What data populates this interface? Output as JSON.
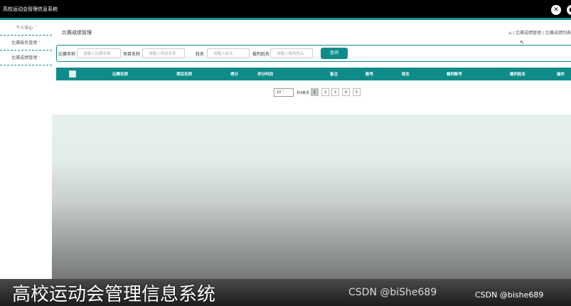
{
  "header": {
    "app_title": "高校运动会管理信息系统",
    "fullscreen_icon": "close-icon",
    "user_icon": "user-icon"
  },
  "sidebar": {
    "items": [
      {
        "label": "个人中心"
      },
      {
        "label": "比赛报名管理"
      },
      {
        "label": "比赛成绩管理"
      }
    ]
  },
  "main": {
    "page_title": "比赛成绩管理",
    "breadcrumb": "⌂ / 比赛成绩管理 / 比赛成绩列表"
  },
  "search": {
    "fields": [
      {
        "label": "比赛名称",
        "placeholder": "请输入比赛名称"
      },
      {
        "label": "项目名称",
        "placeholder": "请输入项目名称"
      },
      {
        "label": "姓名",
        "placeholder": "请输入姓名"
      },
      {
        "label": "裁判姓名",
        "placeholder": "请输入裁判姓名"
      }
    ],
    "button": "查询"
  },
  "table": {
    "columns": [
      "比赛名称",
      "项目名称",
      "得分",
      "评分时间",
      "备注",
      "账号",
      "姓名",
      "裁判账号",
      "裁判姓名",
      "操作"
    ]
  },
  "pagination": {
    "page_size": "10",
    "total_text": "共4条页",
    "pages": [
      "1",
      "2",
      "3",
      "4",
      "5"
    ],
    "active_page": "1"
  },
  "overlay": {
    "caption": "高校运动会管理信息系统",
    "watermark_left": "CSDN @biShe689",
    "watermark_right": "CSDN @bishe689"
  },
  "colors": {
    "accent": "#0f8c8a",
    "topbar": "#000000"
  }
}
